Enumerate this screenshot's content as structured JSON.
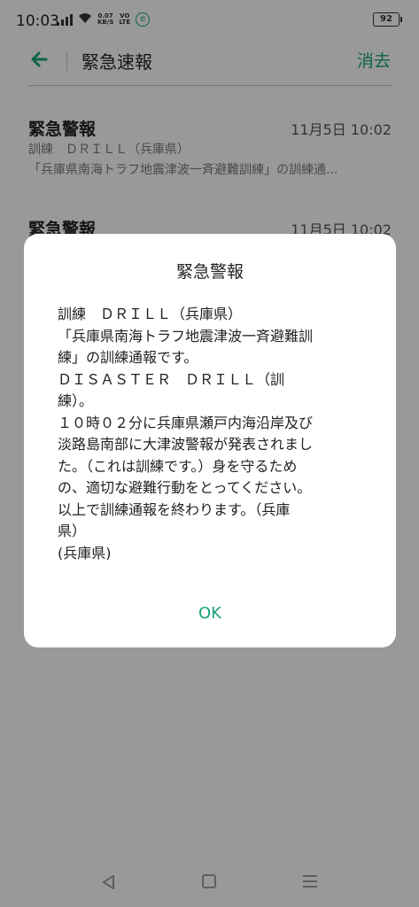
{
  "status_bar": {
    "time": "10:03",
    "net_speed": "0.07",
    "net_unit": "KB/S",
    "volte_top": "VO",
    "volte_bottom": "LTE",
    "e_badge": "e",
    "battery": "92"
  },
  "header": {
    "title": "緊急速報",
    "delete_label": "消去"
  },
  "messages": [
    {
      "title": "緊急警報",
      "time": "11月5日 10:02",
      "line1": "訓練　ＤＲＩＬＬ（兵庫県）",
      "line2": "「兵庫県南海トラフ地震津波一斉避難訓練」の訓練通..."
    },
    {
      "title": "緊急警報",
      "time": "11月5日 10:02"
    }
  ],
  "dialog": {
    "title": "緊急警報",
    "body_lines": [
      "訓練　ＤＲＩＬＬ（兵庫県）",
      "「兵庫県南海トラフ地震津波一斉避難訓",
      "練」の訓練通報です。",
      "ＤＩＳＡＳＴＥＲ　ＤＲＩＬＬ（訓",
      "練）。",
      "１０時０２分に兵庫県瀬戸内海沿岸及び",
      "淡路島南部に大津波警報が発表されまし",
      "た。（これは訓練です。）身を守るため",
      "の、適切な避難行動をとってください。",
      "以上で訓練通報を終わります。（兵庫",
      "県）",
      "(兵庫県)"
    ],
    "ok_label": "OK"
  },
  "colors": {
    "accent": "#17a37a",
    "overlay": "rgba(0,0,0,0.38)"
  },
  "icons": {
    "back": "arrow-left-icon",
    "nav_back": "triangle-back-icon",
    "nav_home": "square-home-icon",
    "nav_menu": "hamburger-menu-icon"
  }
}
